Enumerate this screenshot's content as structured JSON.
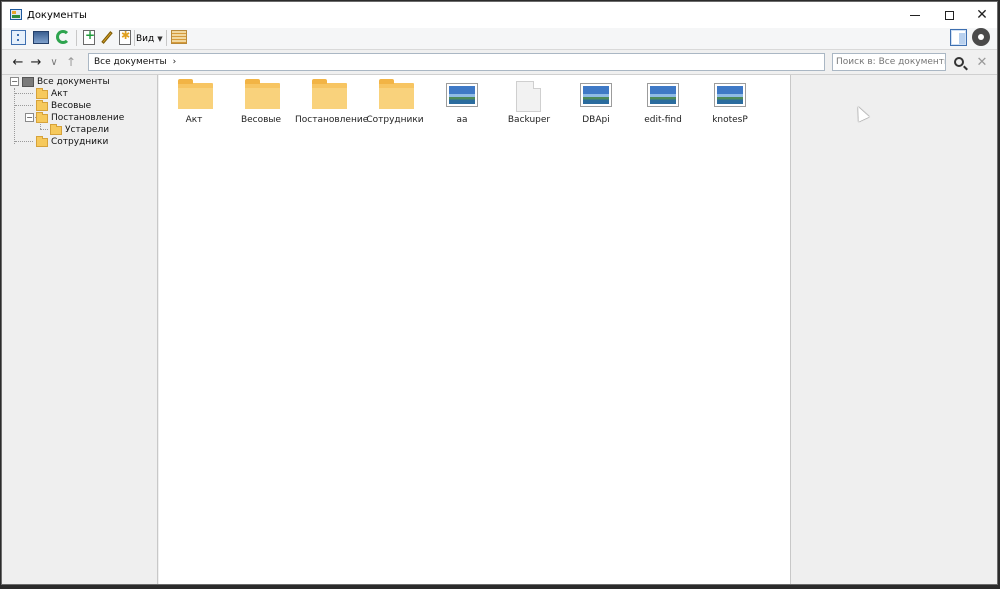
{
  "window": {
    "title": "Документы",
    "minimize_symbol": "",
    "maximize_symbol": "",
    "close_symbol": "✕"
  },
  "toolbar": {
    "view_label": "Вид",
    "icons": [
      "document-list-icon",
      "scanner-icon",
      "refresh-icon",
      "new-document-icon",
      "edit-icon",
      "new-star-icon",
      "barcode-icon",
      "preview-panel-icon",
      "gear-icon"
    ]
  },
  "navigation": {
    "back": "←",
    "forward": "→",
    "history": "∨",
    "up": "↑",
    "address": {
      "path": "Все документы",
      "separator": "›"
    },
    "search": {
      "placeholder": "Поиск в: Все документы"
    },
    "clear": "✕"
  },
  "tree": {
    "root": "Все документы",
    "items": [
      {
        "label": "Акт"
      },
      {
        "label": "Весовые"
      },
      {
        "label": "Постановление",
        "children": [
          {
            "label": "Устарели"
          }
        ]
      },
      {
        "label": "Сотрудники"
      }
    ],
    "toggle_expanded": "−"
  },
  "content": {
    "items": [
      {
        "label": "Акт",
        "kind": "folder"
      },
      {
        "label": "Весовые",
        "kind": "folder"
      },
      {
        "label": "Постановление",
        "kind": "folder"
      },
      {
        "label": "Сотрудники",
        "kind": "folder"
      },
      {
        "label": "aa",
        "kind": "image"
      },
      {
        "label": "Backuper",
        "kind": "file"
      },
      {
        "label": "DBApi",
        "kind": "image"
      },
      {
        "label": "edit-find",
        "kind": "image"
      },
      {
        "label": "knotesP",
        "kind": "image"
      }
    ]
  },
  "colors": {
    "folder": "#f7c562",
    "accent": "#3e6fb0",
    "pane_background": "#efefef"
  }
}
